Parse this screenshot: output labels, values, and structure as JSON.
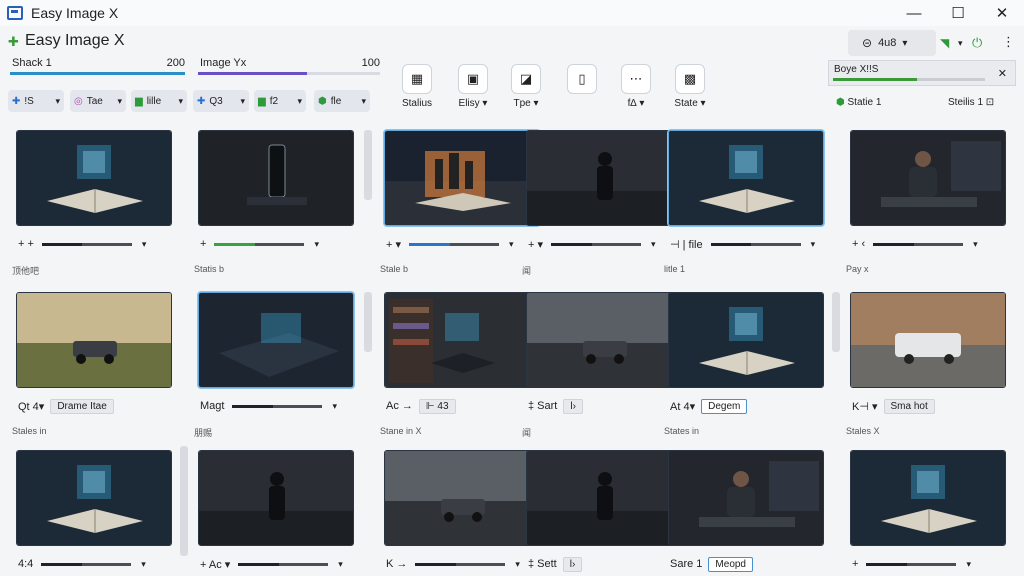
{
  "window": {
    "title": "Easy Image X",
    "controls": [
      "—",
      "☐",
      "✕"
    ]
  },
  "app": {
    "title": "Easy Image X"
  },
  "status_pill": {
    "text": "4u8"
  },
  "trackers": [
    {
      "label": "Shack 1",
      "value": "200",
      "fill": 1.0,
      "color": "#2b8fc7"
    },
    {
      "label": "Image Yx",
      "value": "100",
      "fill": 0.6,
      "color": "#6a4fc7"
    }
  ],
  "chips": [
    {
      "icon": "✚",
      "label": "!S",
      "color": "#2a6fd0"
    },
    {
      "icon": "◎",
      "label": "Tae",
      "color": "#b04bb0"
    },
    {
      "icon": "▆",
      "label": "lille",
      "color": "#2e9b3a"
    },
    {
      "icon": "✚",
      "label": "Q3",
      "color": "#2a6fd0"
    },
    {
      "icon": "▆",
      "label": "f2",
      "color": "#2e9b3a"
    },
    {
      "icon": "⬢",
      "label": "fle",
      "color": "#2e9b3a"
    }
  ],
  "toolbar": [
    {
      "icon": "▦",
      "label": "Stalius"
    },
    {
      "icon": "▣",
      "label": "Elisy ▾"
    },
    {
      "icon": "◪",
      "label": "Tpe ▾"
    },
    {
      "icon": "▯",
      "label": ""
    },
    {
      "icon": "⋯",
      "label": "f∆ ▾"
    },
    {
      "icon": "▩",
      "label": "State ▾"
    }
  ],
  "status_card": {
    "title": "Boye X!!S",
    "fill": 0.55
  },
  "right_status": [
    {
      "label": "Statie 1"
    },
    {
      "label": "Steilis 1"
    }
  ],
  "rows": [
    {
      "captions": [
        "顶他吧",
        "Statis b",
        "Stale b",
        "闻",
        "litle 1",
        "Pay x"
      ],
      "controls": [
        "+ +",
        "+",
        "+ ▾",
        "+ ▾",
        "⊣ | file",
        "+ ‹"
      ],
      "buttons": []
    },
    {
      "captions": [
        "Stales in",
        "朋赐",
        "Stane in X",
        "闻",
        "States in",
        "Stales X"
      ],
      "controls": [
        "Qt  4▾",
        "Magt",
        "Ac  →",
        "‡  Sart",
        "At  4▾",
        "K⊣  ▾"
      ],
      "buttons": [
        "Drame Itae",
        "",
        "⊩ 43",
        "l›",
        "Degem",
        "Sma hot"
      ]
    },
    {
      "captions": [
        "",
        "",
        "",
        "",
        "",
        ""
      ],
      "controls": [
        "4:4",
        "+  Ac ▾",
        "K  →",
        "‡  Sett",
        "Sare 1",
        "+"
      ],
      "buttons": [
        "",
        "",
        "",
        "l›",
        "Meopd",
        ""
      ]
    }
  ],
  "colors": {
    "accent_blue": "#2b8fc7",
    "accent_green": "#3a9a3a",
    "glow": "#3fb4e8"
  }
}
